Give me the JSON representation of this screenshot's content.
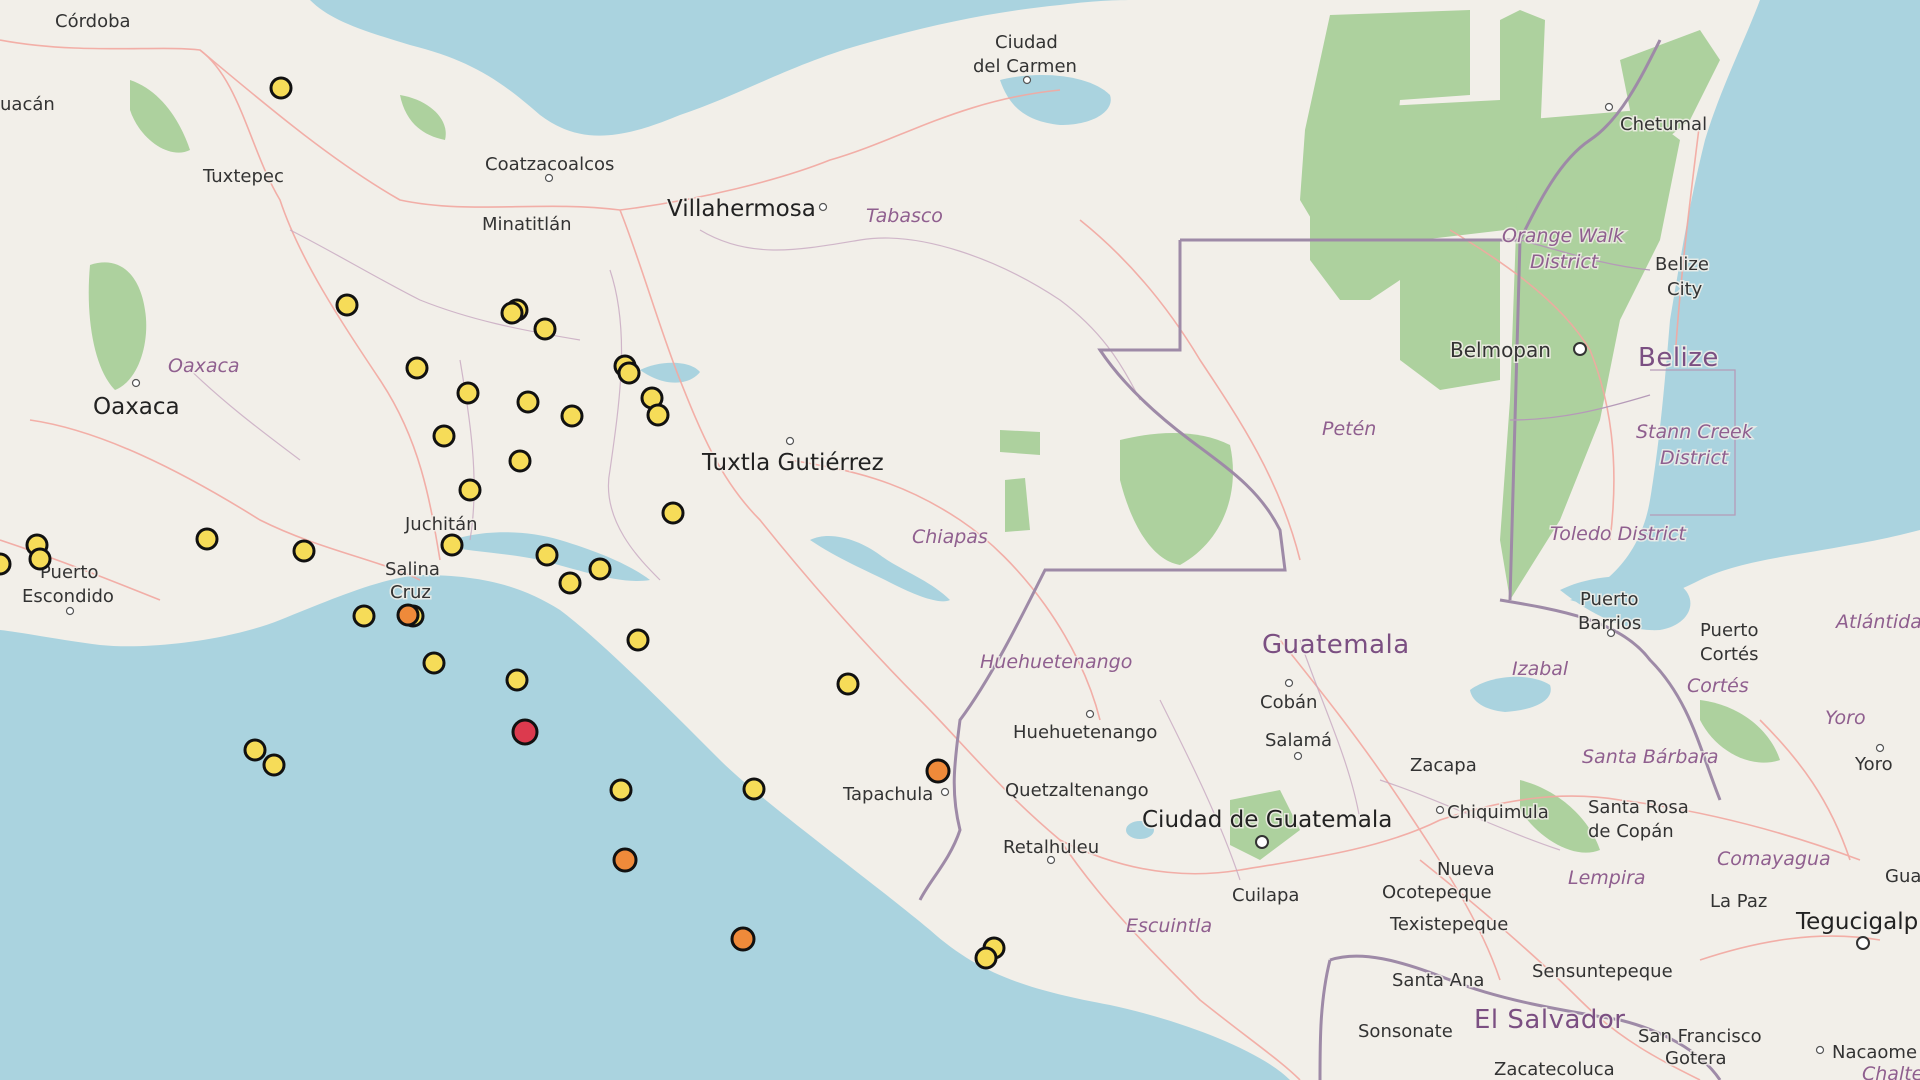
{
  "map": {
    "places": [
      {
        "name": "Córdoba"
      },
      {
        "name": "uacán"
      },
      {
        "name": "Tuxtepec"
      },
      {
        "name": "Oaxaca"
      },
      {
        "name": "Puerto"
      },
      {
        "name": "Escondido"
      },
      {
        "name": "Coatzacoalcos"
      },
      {
        "name": "Minatitlán"
      },
      {
        "name": "Villahermosa"
      },
      {
        "name": "Ciudad"
      },
      {
        "name": "del Carmen"
      },
      {
        "name": "Juchitán"
      },
      {
        "name": "Salina"
      },
      {
        "name": "Cruz"
      },
      {
        "name": "Tuxtla Gutiérrez"
      },
      {
        "name": "Tapachula"
      },
      {
        "name": "Chetumal"
      },
      {
        "name": "Belize"
      },
      {
        "name": "City"
      },
      {
        "name": "Belmopan"
      },
      {
        "name": "Huehuetenango"
      },
      {
        "name": "Quetzaltenango"
      },
      {
        "name": "Retalhuleu"
      },
      {
        "name": "Cobán"
      },
      {
        "name": "Salamá"
      },
      {
        "name": "Ciudad de Guatemala"
      },
      {
        "name": "Zacapa"
      },
      {
        "name": "Chiquimula"
      },
      {
        "name": "Cuilapa"
      },
      {
        "name": "Nueva"
      },
      {
        "name": "Ocotepeque"
      },
      {
        "name": "Texistepeque"
      },
      {
        "name": "Santa Ana"
      },
      {
        "name": "Sonsonate"
      },
      {
        "name": "Sensuntepeque"
      },
      {
        "name": "Zacatecoluca"
      },
      {
        "name": "San Francisco"
      },
      {
        "name": "Gotera"
      },
      {
        "name": "Nacaome"
      },
      {
        "name": "Tegucigalp"
      },
      {
        "name": "La Paz"
      },
      {
        "name": "Santa Rosa"
      },
      {
        "name": "de Copán"
      },
      {
        "name": "Puerto"
      },
      {
        "name": "Barrios"
      },
      {
        "name": "Puerto"
      },
      {
        "name": "Cortés"
      },
      {
        "name": "Yoro"
      },
      {
        "name": "Gua"
      }
    ],
    "regions": [
      {
        "name": "Oaxaca"
      },
      {
        "name": "Tabasco"
      },
      {
        "name": "Chiapas"
      },
      {
        "name": "Petén"
      },
      {
        "name": "Orange Walk"
      },
      {
        "name": "District"
      },
      {
        "name": "Stann Creek"
      },
      {
        "name": "District"
      },
      {
        "name": "Toledo District"
      },
      {
        "name": "Huehuetenango"
      },
      {
        "name": "Izabal"
      },
      {
        "name": "Escuintla"
      },
      {
        "name": "Cortés"
      },
      {
        "name": "Santa Bárbara"
      },
      {
        "name": "Lempira"
      },
      {
        "name": "Comayagua"
      },
      {
        "name": "Yoro"
      },
      {
        "name": "Atlántida"
      },
      {
        "name": "Chaltenango"
      }
    ],
    "countries": [
      {
        "name": "Guatemala"
      },
      {
        "name": "Belize"
      },
      {
        "name": "El Salvador"
      }
    ]
  },
  "colors": {
    "water": "#aad3df",
    "land": "#f2efe9",
    "forest": "#add19e",
    "border": "#9e8aa7",
    "road": "#f3a7a0",
    "quake_low": "#f6dc58",
    "quake_mid": "#ef8a3a",
    "quake_high": "#dc3a4e"
  }
}
